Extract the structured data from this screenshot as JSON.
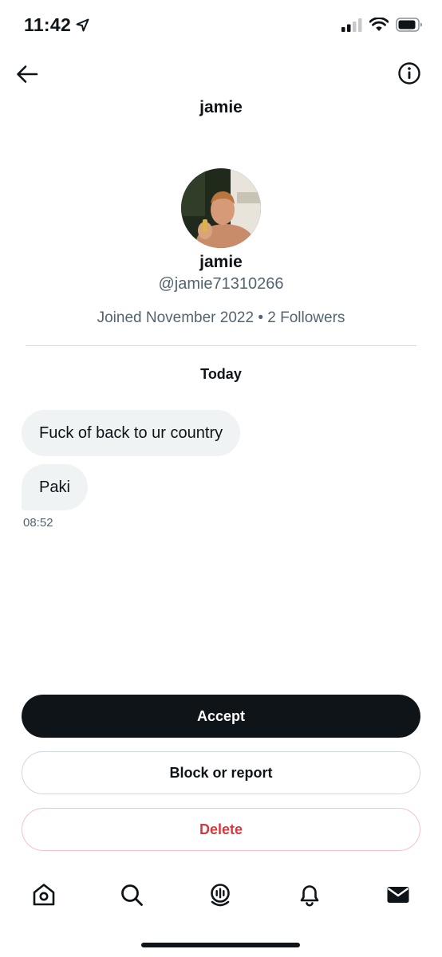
{
  "status_bar": {
    "time": "11:42",
    "icons": [
      "location-arrow-icon",
      "cellular-signal-icon",
      "wifi-icon",
      "battery-icon"
    ]
  },
  "header": {
    "title": "jamie",
    "back_icon": "back-arrow-icon",
    "info_icon": "info-icon"
  },
  "profile": {
    "name": "jamie",
    "handle": "@jamie71310266",
    "meta": "Joined November 2022 • 2 Followers"
  },
  "conversation": {
    "day_label": "Today",
    "messages": [
      {
        "text": "Fuck of back to ur country"
      },
      {
        "text": "Paki"
      }
    ],
    "last_time": "08:52"
  },
  "actions": {
    "accept_label": "Accept",
    "block_label": "Block or report",
    "delete_label": "Delete"
  },
  "bottom_nav": {
    "items": [
      "home-icon",
      "search-icon",
      "spaces-icon",
      "notifications-icon",
      "messages-icon"
    ]
  },
  "colors": {
    "text_primary": "#0f1419",
    "text_secondary": "#536471",
    "bubble_bg": "#eff3f4",
    "accept_bg": "#0f1419",
    "delete_text": "#d7383d",
    "divider": "#cfd9de"
  }
}
